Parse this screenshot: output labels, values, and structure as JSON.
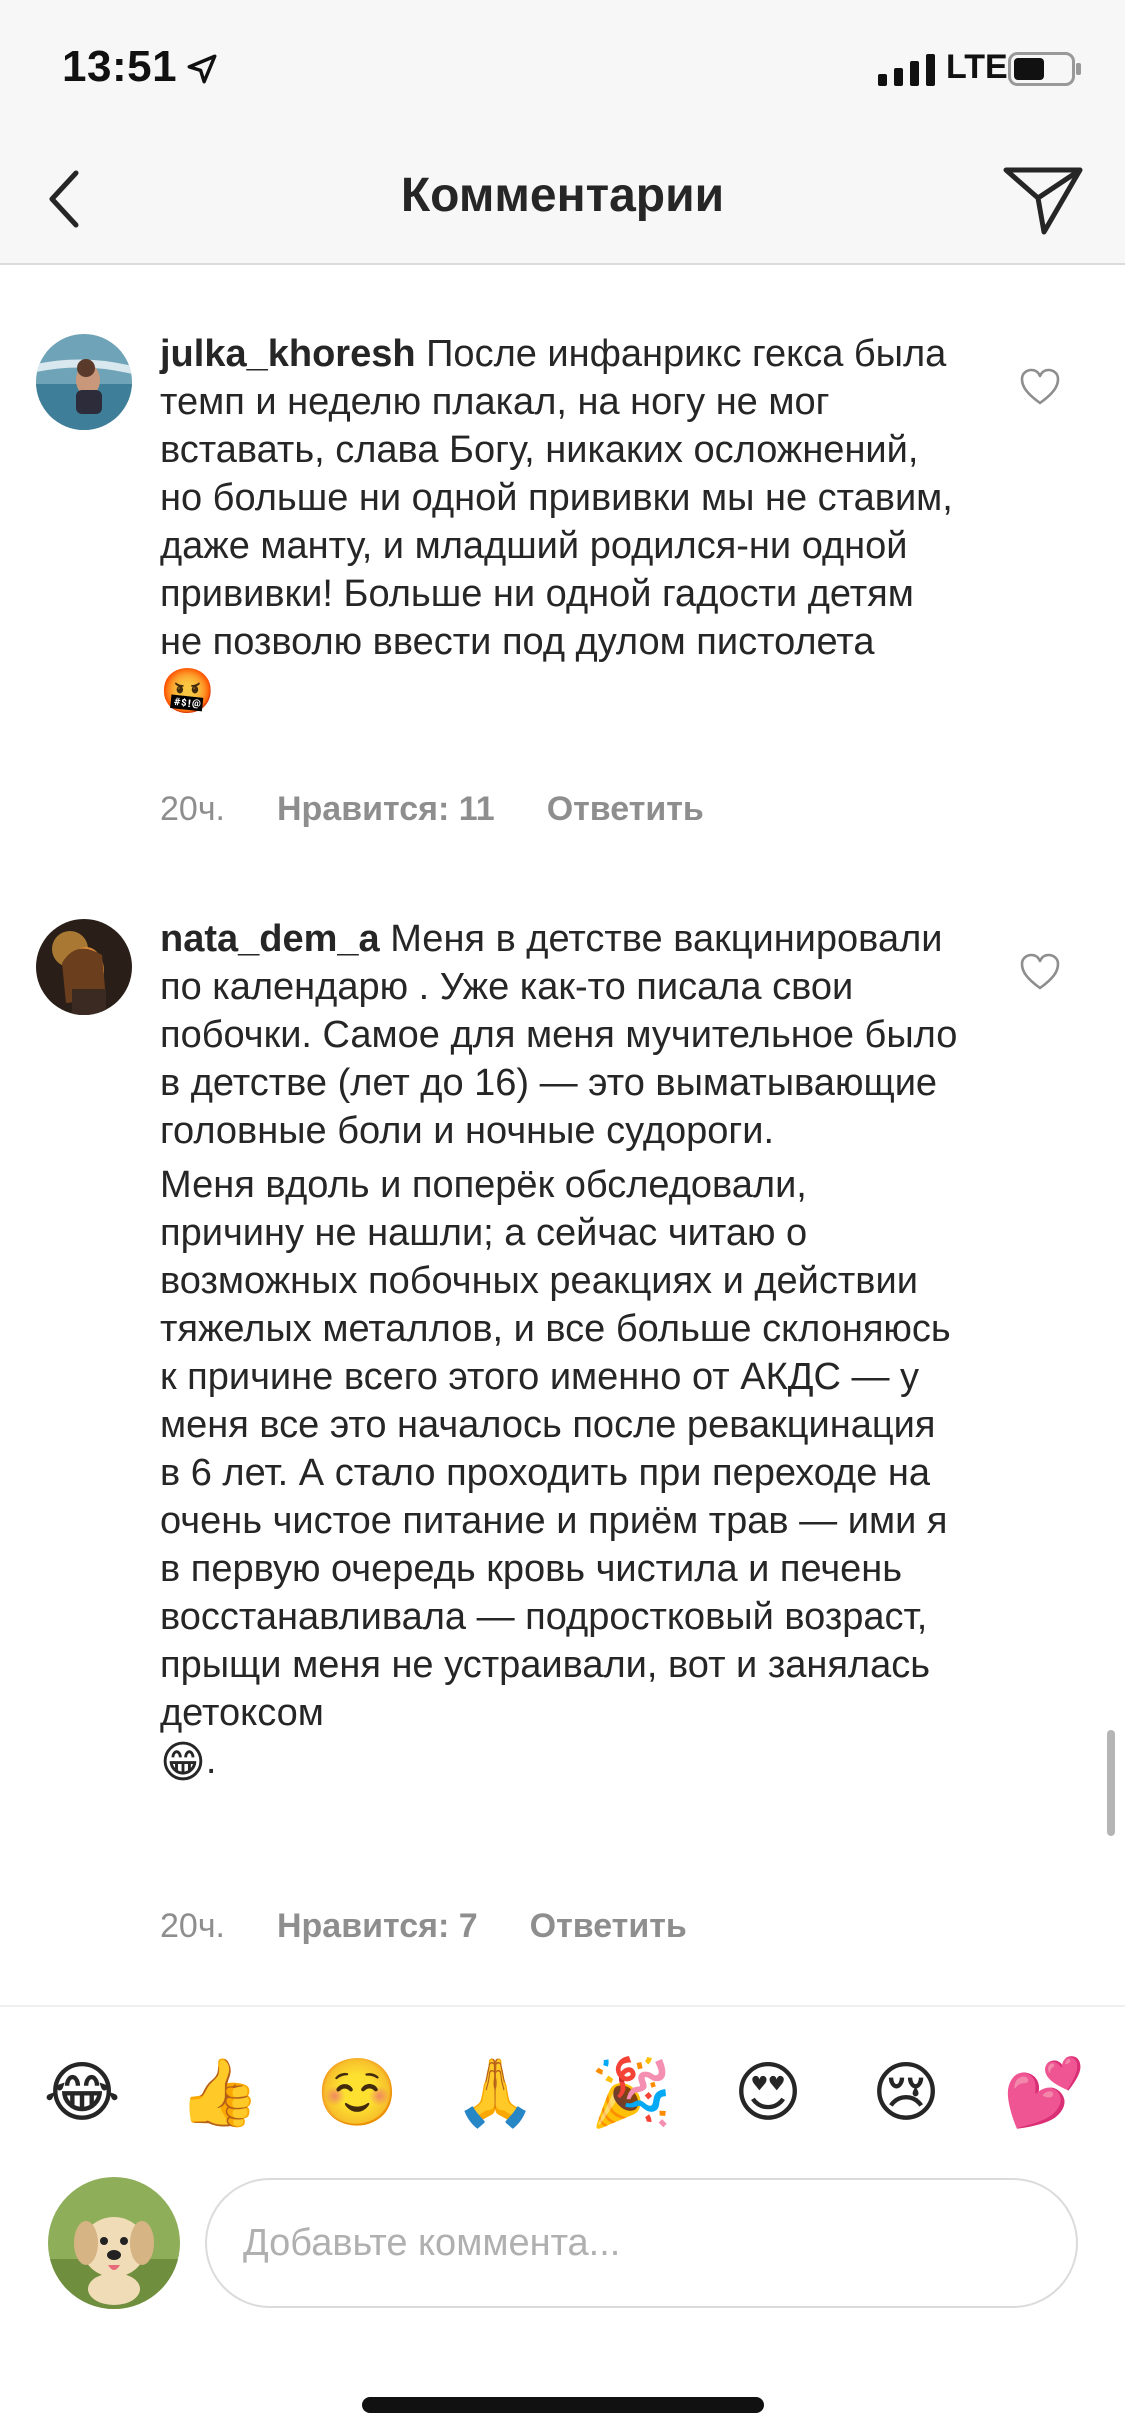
{
  "status_bar": {
    "time": "13:51",
    "carrier": "LTE"
  },
  "nav": {
    "title": "Комментарии",
    "back_icon": "chevron-left-icon",
    "send_icon": "paper-plane-icon"
  },
  "comments": [
    {
      "username": "julka_khoresh",
      "text": " После инфанрикс гекса была темп и неделю плакал, на ногу не мог вставать, слава Богу, никаких осложнений, но больше ни одной прививки мы не ставим, даже манту, и младший родился-ни одной прививки! Больше ни одной гадости детям не позволю ввести под дулом пистолета",
      "trailing_emoji": "🤬",
      "age": "20ч.",
      "likes": "Нравится: 11",
      "reply": "Ответить"
    },
    {
      "username": "nata_dem_a",
      "text": " Меня в детстве вакцинировали по календарю . Уже как-то писала свои побочки. Самое для меня мучительное было в детстве (лет до 16) — это выматывающие головные боли и ночные судороги.",
      "text2": "Меня вдоль и поперёк обследовали, причину не нашли; а сейчас читаю о возможных побочных реакциях и действии тяжелых металлов, и все больше склоняюсь к причине всего этого именно от АКДС — у меня все это началось после ревакцинация в 6 лет. А стало проходить при переходе на очень чистое питание и приём трав — ими я в первую очередь кровь чистила и печень восстанавливала — подростковый возраст, прыщи меня не устраивали, вот и занялась детоксом",
      "trailing_emoji": "😁",
      "trailing_text": ".",
      "age": "20ч.",
      "likes": "Нравится: 7",
      "reply": "Ответить"
    }
  ],
  "emoji_bar": [
    "😂",
    "👍",
    "☺️",
    "🙏",
    "🎉",
    "😍",
    "😢",
    "💕"
  ],
  "input": {
    "placeholder": "Добавьте коммента..."
  }
}
